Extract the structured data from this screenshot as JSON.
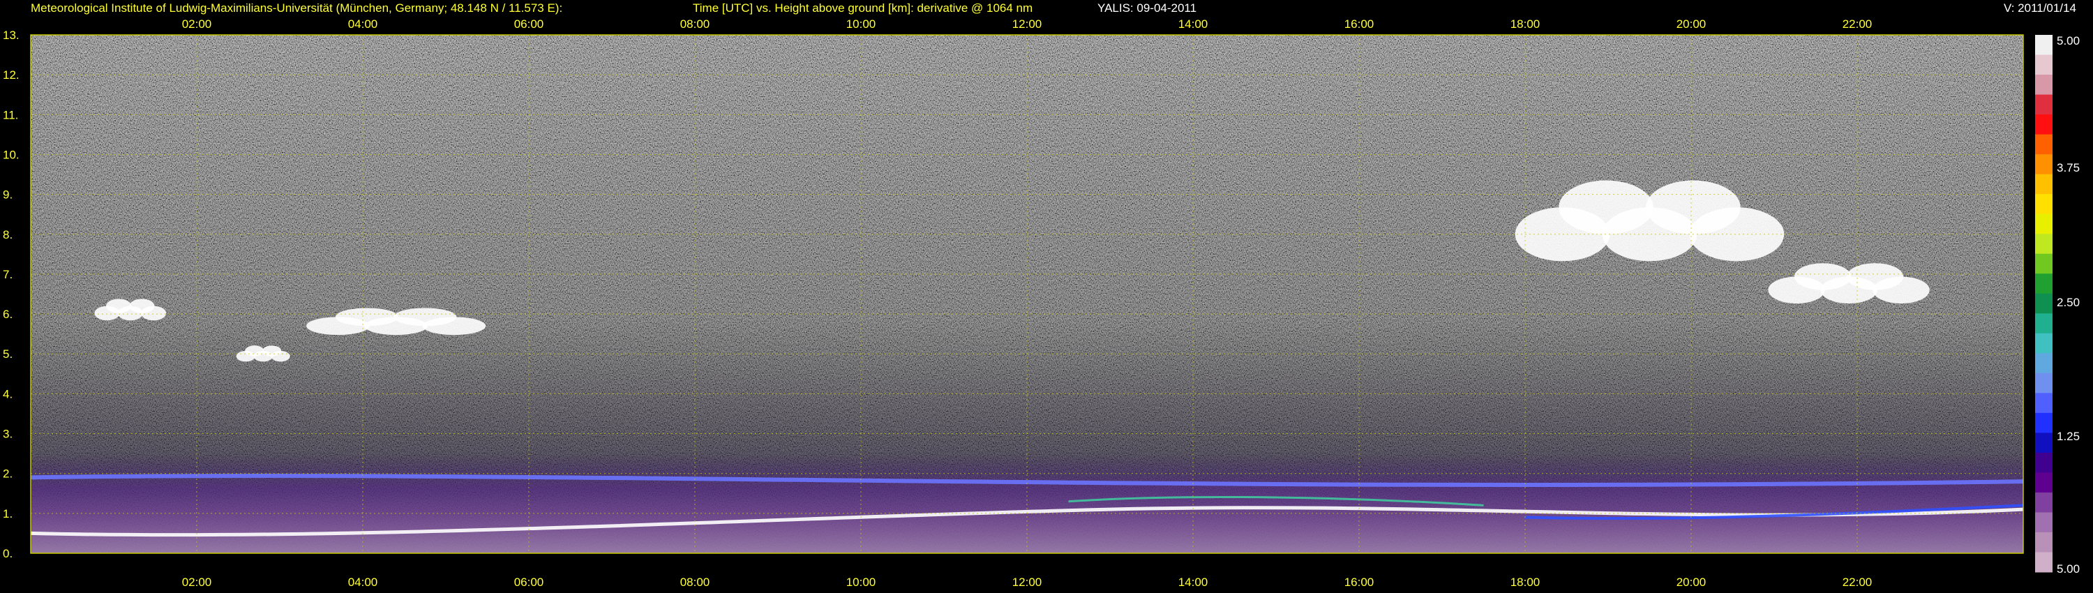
{
  "header": {
    "institute": "Meteorological Institute of Ludwig-Maximilians-Universität (München, Germany; 48.148 N / 11.573 E):",
    "axes_description": "Time [UTC] vs. Height above ground [km]: derivative @ 1064 nm",
    "instrument_date": "YALIS: 09-04-2011",
    "version": "V: 2011/01/14"
  },
  "colors": {
    "background": "#000000",
    "label_yellow": "#ffff33",
    "grid": "#c8c800"
  },
  "chart_data": {
    "type": "heatmap",
    "title": "Time [UTC] vs. Height above ground [km]: derivative @ 1064 nm",
    "x_ticks_top": [
      "02:00",
      "04:00",
      "06:00",
      "08:00",
      "10:00",
      "12:00",
      "14:00",
      "16:00",
      "18:00",
      "20:00",
      "22:00"
    ],
    "x_ticks_bottom": [
      "02:00",
      "04:00",
      "06:00",
      "08:00",
      "10:00",
      "12:00",
      "14:00",
      "16:00",
      "18:00",
      "20:00",
      "22:00"
    ],
    "x_tick_hours": [
      2,
      4,
      6,
      8,
      10,
      12,
      14,
      16,
      18,
      20,
      22
    ],
    "xlim_hours": [
      0,
      24
    ],
    "y_ticks": [
      "0.",
      "1.",
      "2.",
      "3.",
      "4.",
      "5.",
      "6.",
      "7.",
      "8.",
      "9.",
      "10.",
      "11.",
      "12.",
      "13."
    ],
    "ylim_km": [
      0,
      13
    ],
    "grid": true,
    "colorbar": {
      "ticks": [
        "5.00",
        "3.75",
        "2.50",
        "1.25",
        "5.00"
      ],
      "tick_values": [
        5.0,
        3.75,
        2.5,
        1.25,
        0
      ],
      "range": [
        0,
        5.0
      ],
      "colors": [
        "#f0f0f0",
        "#e8c8d0",
        "#d898a8",
        "#e03040",
        "#ff1010",
        "#ff6000",
        "#ff9000",
        "#ffc000",
        "#ffe000",
        "#e8f000",
        "#c0e820",
        "#70c820",
        "#20a030",
        "#109050",
        "#20b090",
        "#40c0c0",
        "#60a8e0",
        "#7090f0",
        "#5060ff",
        "#2030ff",
        "#1010c0",
        "#400090",
        "#600090",
        "#8040a0",
        "#a070b0",
        "#b890b8",
        "#d0b0c8"
      ]
    },
    "features": [
      {
        "name": "cloud",
        "time_hours": [
          0.8,
          1.6
        ],
        "height_km": [
          5.7,
          6.5
        ]
      },
      {
        "name": "cloud",
        "time_hours": [
          2.5,
          3.1
        ],
        "height_km": [
          4.7,
          5.3
        ]
      },
      {
        "name": "cloud",
        "time_hours": [
          3.4,
          5.4
        ],
        "height_km": [
          5.3,
          6.3
        ]
      },
      {
        "name": "cloud",
        "time_hours": [
          18.0,
          21.0
        ],
        "height_km": [
          6.8,
          9.8
        ]
      },
      {
        "name": "cloud",
        "time_hours": [
          21.0,
          22.8
        ],
        "height_km": [
          6.0,
          7.5
        ]
      },
      {
        "name": "boundary-layer",
        "time_hours": [
          0,
          24
        ],
        "height_km": [
          0,
          2.5
        ]
      }
    ]
  }
}
